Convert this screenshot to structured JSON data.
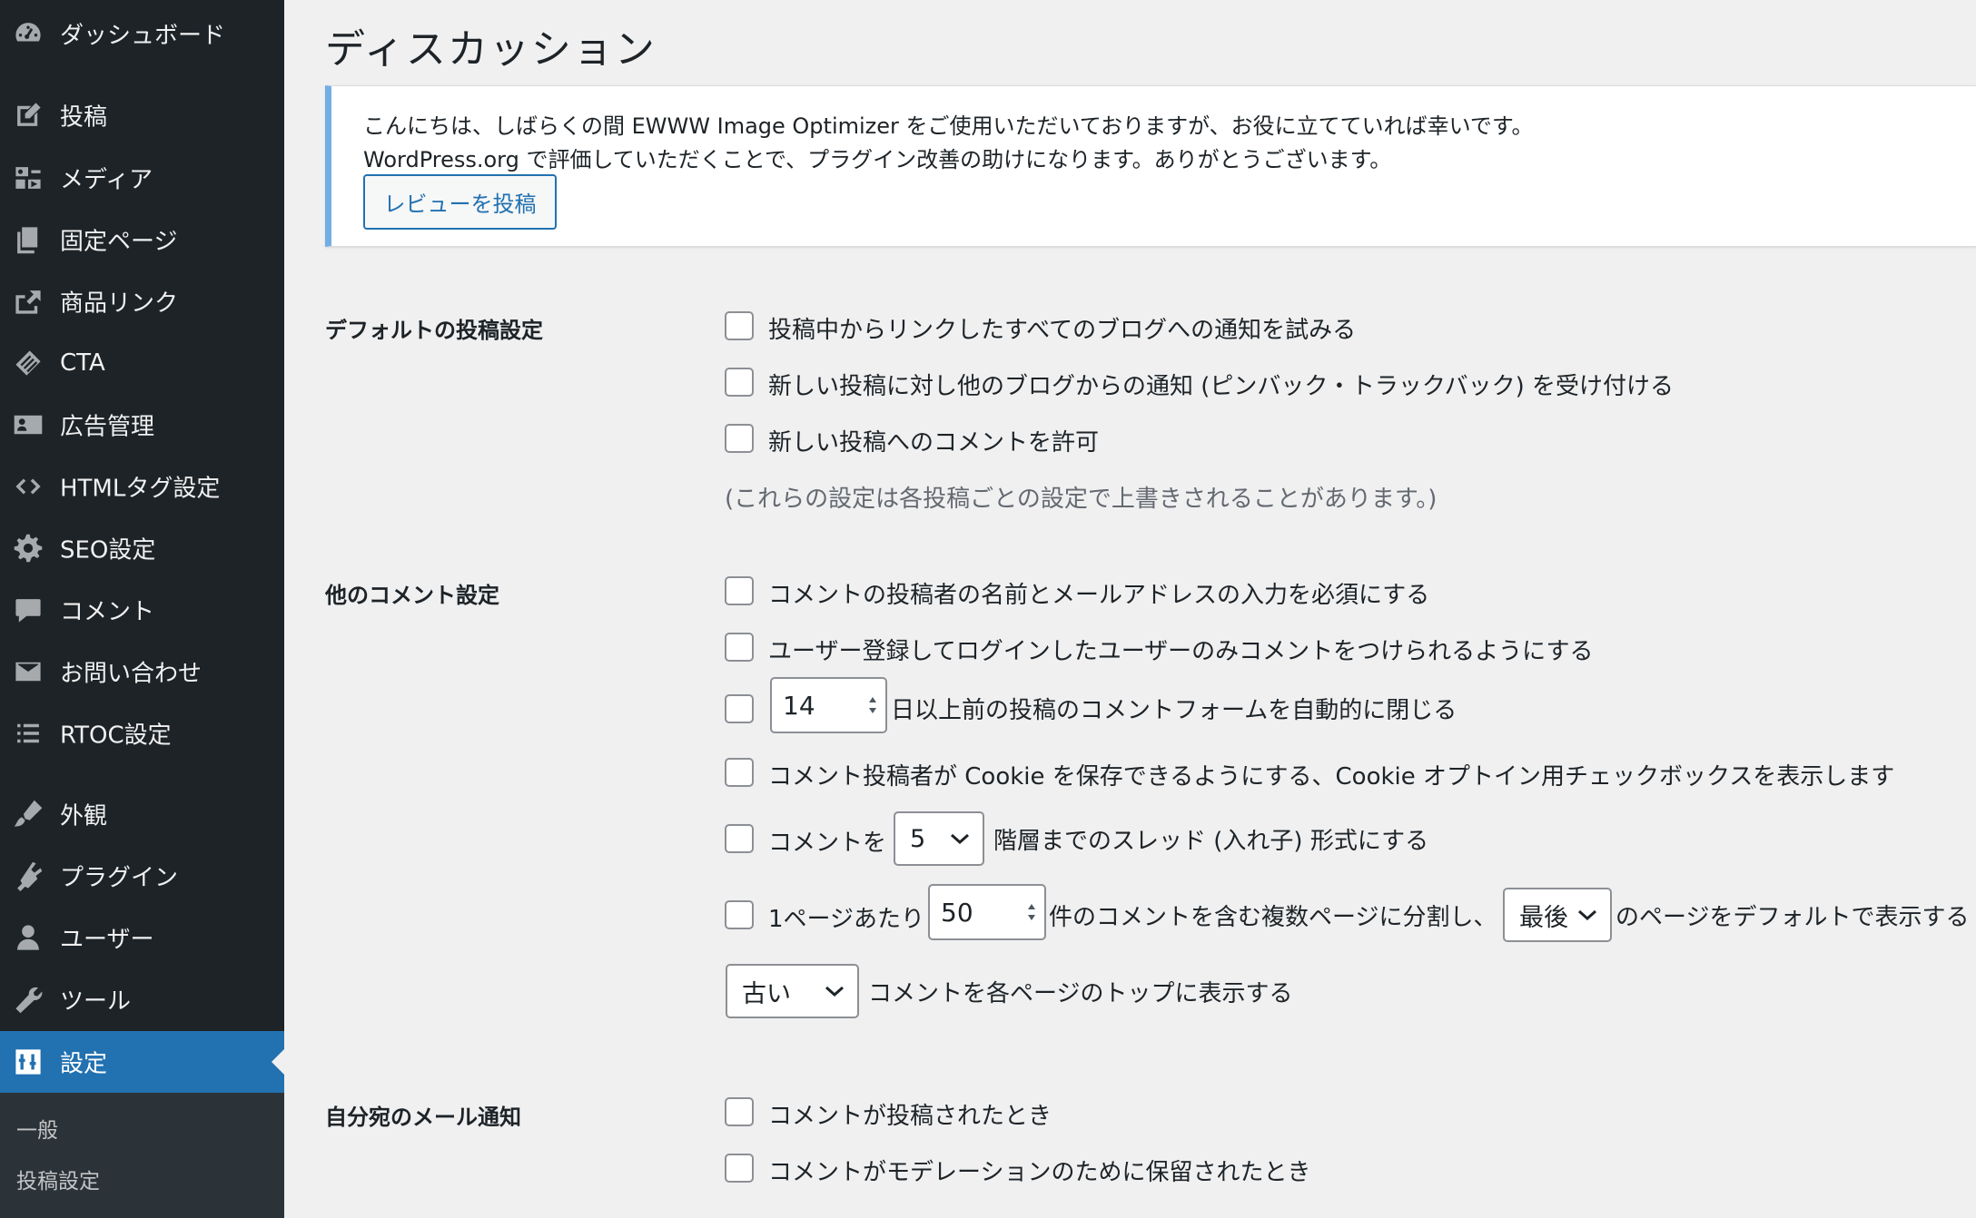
{
  "sidebar": {
    "items": [
      {
        "label": "ダッシュボード",
        "icon": "dashboard-icon"
      },
      {
        "label": "投稿",
        "icon": "post-icon"
      },
      {
        "label": "メディア",
        "icon": "media-icon"
      },
      {
        "label": "固定ページ",
        "icon": "page-icon"
      },
      {
        "label": "商品リンク",
        "icon": "product-link-icon"
      },
      {
        "label": "CTA",
        "icon": "cta-icon"
      },
      {
        "label": "広告管理",
        "icon": "ad-icon"
      },
      {
        "label": "HTMLタグ設定",
        "icon": "code-icon"
      },
      {
        "label": "SEO設定",
        "icon": "gear-icon"
      },
      {
        "label": "コメント",
        "icon": "comment-icon"
      },
      {
        "label": "お問い合わせ",
        "icon": "mail-icon"
      },
      {
        "label": "RTOC設定",
        "icon": "list-icon"
      },
      {
        "label": "外観",
        "icon": "appearance-icon"
      },
      {
        "label": "プラグイン",
        "icon": "plugin-icon"
      },
      {
        "label": "ユーザー",
        "icon": "user-icon"
      },
      {
        "label": "ツール",
        "icon": "wrench-icon"
      },
      {
        "label": "設定",
        "icon": "settings-icon"
      }
    ],
    "submenu": [
      "一般",
      "投稿設定"
    ]
  },
  "page": {
    "title": "ディスカッション"
  },
  "notice": {
    "line1": "こんにちは、しばらくの間 EWWW Image Optimizer をご使用いただいておりますが、お役に立てていれば幸いです。",
    "line2": "WordPress.org で評価していただくことで、プラグイン改善の助けになります。ありがとうございます。",
    "button": "レビューを投稿"
  },
  "default_post": {
    "label": "デフォルトの投稿設定",
    "opt1": "投稿中からリンクしたすべてのブログへの通知を試みる",
    "opt2": "新しい投稿に対し他のブログからの通知 (ピンバック・トラックバック) を受け付ける",
    "opt3": "新しい投稿へのコメントを許可",
    "hint": "(これらの設定は各投稿ごとの設定で上書きされることがあります。)"
  },
  "other_comment": {
    "label": "他のコメント設定",
    "opt1": "コメントの投稿者の名前とメールアドレスの入力を必須にする",
    "opt2": "ユーザー登録してログインしたユーザーのみコメントをつけられるようにする",
    "close_days_value": "14",
    "opt3": "日以上前の投稿のコメントフォームを自動的に閉じる",
    "opt4": "コメント投稿者が Cookie を保存できるようにする、Cookie オプトイン用チェックボックスを表示します",
    "thread_prefix": "コメントを",
    "thread_depth": "5",
    "thread_suffix": "階層までのスレッド (入れ子) 形式にする",
    "page_prefix": "1ページあたり",
    "per_page": "50",
    "page_middle": "件のコメントを含む複数ページに分割し、",
    "page_default": "最後",
    "page_suffix": "のページをデフォルトで表示する",
    "order_value": "古い",
    "order_suffix": "コメントを各ページのトップに表示する"
  },
  "email_notify": {
    "label": "自分宛のメール通知",
    "opt1": "コメントが投稿されたとき",
    "opt2": "コメントがモデレーションのために保留されたとき"
  },
  "colors": {
    "sidebar_bg": "#1d2327",
    "accent": "#2271b1",
    "notice_border": "#72aee6"
  }
}
